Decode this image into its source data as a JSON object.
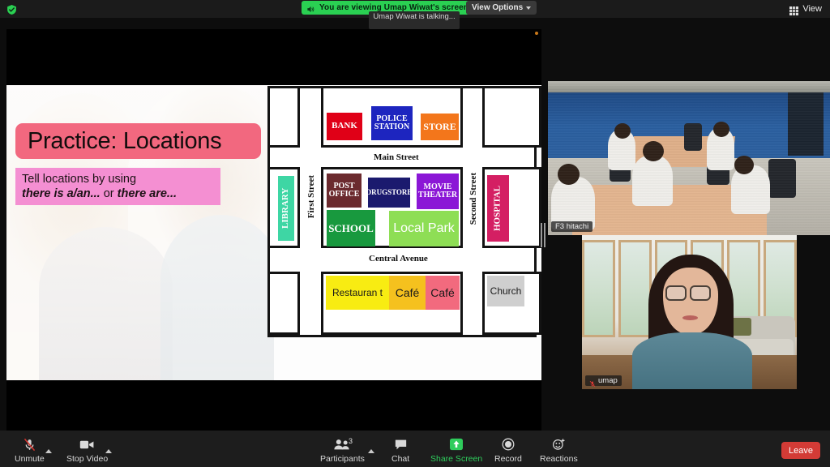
{
  "topbar": {
    "encryption_icon": "shield-check-icon",
    "viewing_banner": {
      "icon": "speaker-icon",
      "text": "You are viewing Umap Wiwat's screen"
    },
    "view_options": {
      "label": "View Options",
      "icon": "chevron-down-icon"
    },
    "view_button": {
      "label": "View",
      "icon": "grid-icon"
    },
    "talking_toast": "Umap Wiwat is talking..."
  },
  "shared_screen": {
    "slide": {
      "title": "Practice: Locations",
      "subtitle_line1": "Tell locations by using",
      "subtitle_line2_a": "there is a/an...",
      "subtitle_line2_mid": " or ",
      "subtitle_line2_b": "there are...",
      "title_bg": "#f2687f",
      "subtitle_bg": "#f48fd2",
      "map": {
        "streets": {
          "main": "Main Street",
          "central": "Central Avenue",
          "first": "First Street",
          "second": "Second Street"
        },
        "places": [
          {
            "name": "BANK",
            "color": "#e00017",
            "text": "#ffffff"
          },
          {
            "name": "POLICE STATION",
            "color": "#1d25bf",
            "text": "#ffffff"
          },
          {
            "name": "STORE",
            "color": "#f3761b",
            "text": "#ffffff"
          },
          {
            "name": "LIBRARY",
            "color": "#3ed6a4",
            "text": "#ffffff"
          },
          {
            "name": "POST OFFICE",
            "color": "#6b2a2e",
            "text": "#ffffff"
          },
          {
            "name": "DRUGSTORE",
            "color": "#1b1a6e",
            "text": "#ffffff"
          },
          {
            "name": "MOVIE THEATER",
            "color": "#8b17d6",
            "text": "#ffffff"
          },
          {
            "name": "SCHOOL",
            "color": "#18993e",
            "text": "#ffffff"
          },
          {
            "name": "Local Park",
            "color": "#8ede55",
            "text": "#ffffff"
          },
          {
            "name": "HOSPITAL",
            "color": "#d41f63",
            "text": "#ffffff"
          },
          {
            "name": "Restauran t",
            "color": "#f8ec12",
            "text": "#1a1a1a"
          },
          {
            "name": "Café",
            "color": "#f5c11e",
            "text": "#1a1a1a"
          },
          {
            "name": "Café",
            "color": "#f26a7e",
            "text": "#1a1a1a"
          },
          {
            "name": "Church",
            "color": "#cfcfcf",
            "text": "#1a1a1a"
          }
        ]
      }
    }
  },
  "videos": [
    {
      "name": "F3 hitachi",
      "muted": false
    },
    {
      "name": "umap",
      "muted": true
    }
  ],
  "toolbar": {
    "mute": {
      "label": "Unmute",
      "icon": "microphone-muted-icon"
    },
    "video": {
      "label": "Stop Video",
      "icon": "video-camera-icon"
    },
    "participants": {
      "label": "Participants",
      "icon": "participants-icon",
      "count": "3"
    },
    "chat": {
      "label": "Chat",
      "icon": "chat-bubble-icon"
    },
    "share": {
      "label": "Share Screen",
      "icon": "share-screen-icon",
      "color": "#2fcc5c"
    },
    "record": {
      "label": "Record",
      "icon": "record-icon"
    },
    "reactions": {
      "label": "Reactions",
      "icon": "reactions-icon"
    },
    "leave": {
      "label": "Leave",
      "color": "#d33b36"
    }
  }
}
